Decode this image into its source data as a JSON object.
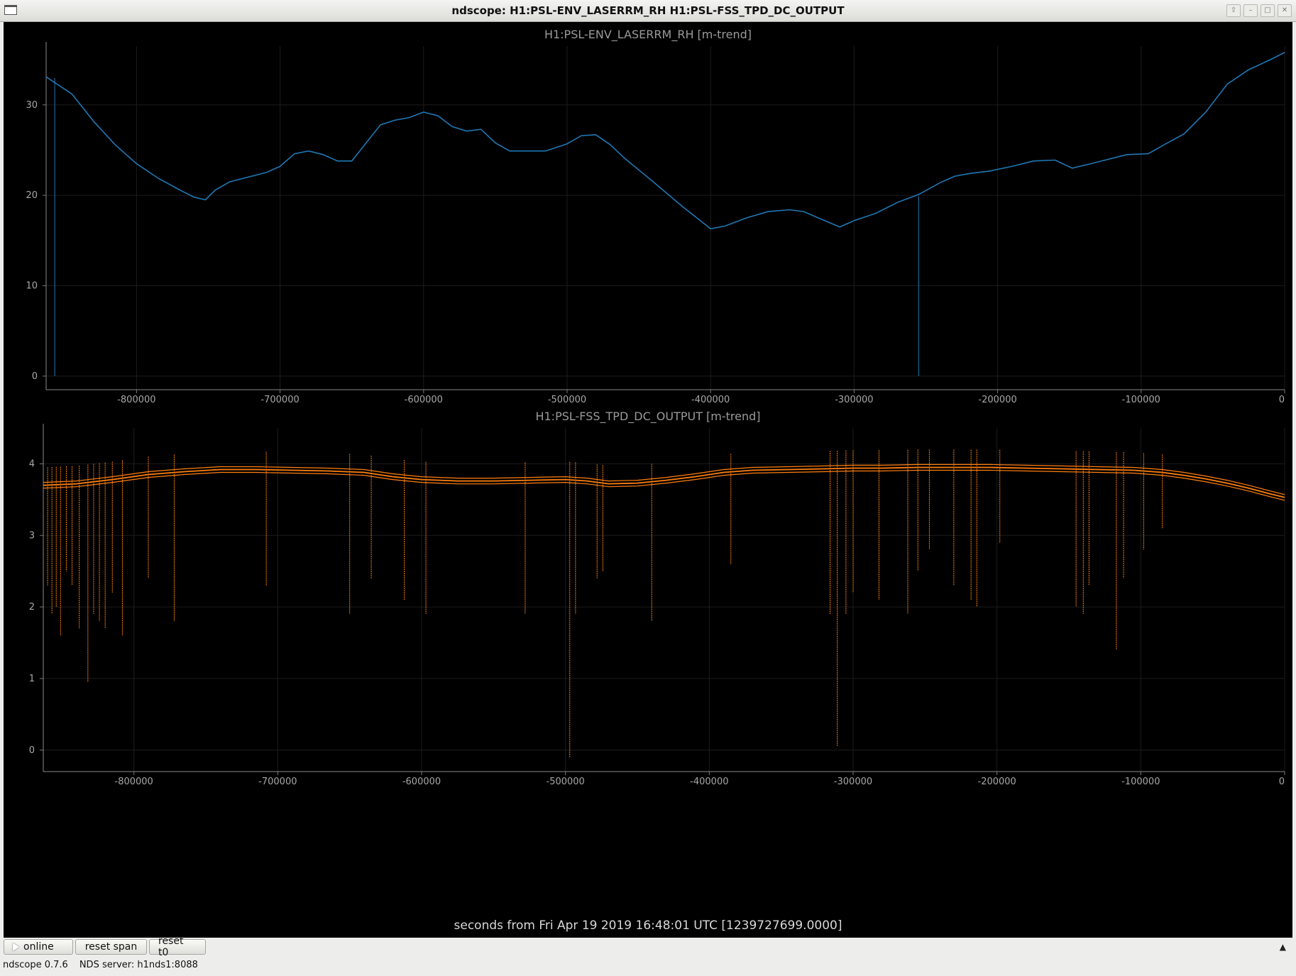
{
  "window": {
    "title": "ndscope: H1:PSL-ENV_LASERRM_RH H1:PSL-FSS_TPD_DC_OUTPUT",
    "buttons": [
      "up-icon",
      "minimize-icon",
      "maximize-icon",
      "close-icon"
    ]
  },
  "plots": [
    {
      "title": "H1:PSL-ENV_LASERRM_RH [m-trend]",
      "color": "#1f77b4",
      "yticks": [
        "0",
        "10",
        "20",
        "30"
      ],
      "xticks": [
        "-800000",
        "-700000",
        "-600000",
        "-500000",
        "-400000",
        "-300000",
        "-200000",
        "-100000",
        "0"
      ]
    },
    {
      "title": "H1:PSL-FSS_TPD_DC_OUTPUT [m-trend]",
      "color": "#ff7f0e",
      "yticks": [
        "0",
        "1",
        "2",
        "3",
        "4"
      ],
      "xticks": [
        "-800000",
        "-700000",
        "-600000",
        "-500000",
        "-400000",
        "-300000",
        "-200000",
        "-100000",
        "0"
      ]
    }
  ],
  "x_axis_label": "seconds from Fri Apr 19 2019 16:48:01 UTC [1239727699.0000]",
  "toolbar": {
    "online_label": "online",
    "reset_span_label": "reset span",
    "reset_t0_label": "reset t0"
  },
  "status": {
    "version": "ndscope 0.7.6",
    "server": "NDS server: h1nds1:8088"
  },
  "chart_data": [
    {
      "type": "line",
      "title": "H1:PSL-ENV_LASERRM_RH [m-trend]",
      "xlim": [
        -863000,
        0
      ],
      "ylim": [
        -1.5,
        36.5
      ],
      "grid": true,
      "series": [
        {
          "color": "#1f77b4",
          "x": [
            -863000,
            -845000,
            -830000,
            -815000,
            -800000,
            -785000,
            -770000,
            -760000,
            -752000,
            -745000,
            -735000,
            -720000,
            -710000,
            -700000,
            -690000,
            -680000,
            -670000,
            -660000,
            -650000,
            -640000,
            -630000,
            -620000,
            -610000,
            -600000,
            -590000,
            -580000,
            -570000,
            -560000,
            -550000,
            -540000,
            -530000,
            -515000,
            -500000,
            -490000,
            -480000,
            -470000,
            -460000,
            -440000,
            -420000,
            -400000,
            -390000,
            -375000,
            -360000,
            -345000,
            -335000,
            -325000,
            -310000,
            -300000,
            -285000,
            -270000,
            -255000,
            -240000,
            -230000,
            -220000,
            -205000,
            -190000,
            -175000,
            -160000,
            -148000,
            -135000,
            -125000,
            -110000,
            -95000,
            -85000,
            -70000,
            -55000,
            -40000,
            -25000,
            -10000,
            0
          ],
          "y": [
            33.1,
            31.2,
            28.2,
            25.6,
            23.5,
            21.9,
            20.6,
            19.8,
            19.5,
            20.6,
            21.5,
            22.1,
            22.5,
            23.2,
            24.6,
            24.9,
            24.5,
            23.8,
            23.8,
            25.8,
            27.8,
            28.3,
            28.6,
            29.2,
            28.8,
            27.6,
            27.1,
            27.3,
            25.8,
            24.9,
            24.9,
            24.9,
            25.7,
            26.6,
            26.7,
            25.6,
            24.1,
            21.5,
            18.8,
            16.3,
            16.6,
            17.5,
            18.2,
            18.4,
            18.2,
            17.5,
            16.5,
            17.2,
            18.0,
            19.2,
            20.1,
            21.4,
            22.1,
            22.4,
            22.7,
            23.2,
            23.8,
            23.9,
            23.0,
            23.5,
            23.9,
            24.5,
            24.6,
            25.5,
            26.8,
            29.2,
            32.3,
            33.9,
            35.0,
            35.8
          ]
        }
      ]
    },
    {
      "type": "line",
      "title": "H1:PSL-FSS_TPD_DC_OUTPUT [m-trend]",
      "xlim": [
        -863000,
        0
      ],
      "ylim": [
        -0.3,
        4.5
      ],
      "grid": true,
      "series": [
        {
          "color": "#ff7f0e",
          "x": [
            -863000,
            -840000,
            -815000,
            -790000,
            -765000,
            -740000,
            -715000,
            -690000,
            -665000,
            -640000,
            -620000,
            -600000,
            -575000,
            -550000,
            -525000,
            -500000,
            -485000,
            -470000,
            -450000,
            -430000,
            -410000,
            -390000,
            -370000,
            -345000,
            -320000,
            -300000,
            -280000,
            -255000,
            -230000,
            -205000,
            -180000,
            -155000,
            -130000,
            -105000,
            -85000,
            -70000,
            -55000,
            -40000,
            -25000,
            -10000,
            0
          ],
          "y": [
            3.7,
            3.72,
            3.78,
            3.85,
            3.89,
            3.92,
            3.92,
            3.91,
            3.9,
            3.88,
            3.82,
            3.78,
            3.76,
            3.76,
            3.77,
            3.78,
            3.76,
            3.72,
            3.73,
            3.77,
            3.82,
            3.88,
            3.91,
            3.92,
            3.93,
            3.94,
            3.94,
            3.95,
            3.95,
            3.95,
            3.94,
            3.93,
            3.92,
            3.91,
            3.88,
            3.84,
            3.79,
            3.73,
            3.66,
            3.58,
            3.53
          ]
        }
      ],
      "dropouts": [
        {
          "x": -860000,
          "y": 2.3
        },
        {
          "x": -857000,
          "y": 1.9
        },
        {
          "x": -854000,
          "y": 2.0
        },
        {
          "x": -851000,
          "y": 1.6
        },
        {
          "x": -847000,
          "y": 2.5
        },
        {
          "x": -843000,
          "y": 2.3
        },
        {
          "x": -838000,
          "y": 1.7
        },
        {
          "x": -832000,
          "y": 0.95
        },
        {
          "x": -828000,
          "y": 1.9
        },
        {
          "x": -824000,
          "y": 1.8
        },
        {
          "x": -820000,
          "y": 1.7
        },
        {
          "x": -815000,
          "y": 2.2
        },
        {
          "x": -808000,
          "y": 1.6
        },
        {
          "x": -790000,
          "y": 2.4
        },
        {
          "x": -772000,
          "y": 1.8
        },
        {
          "x": -708000,
          "y": 2.3
        },
        {
          "x": -650000,
          "y": 1.9
        },
        {
          "x": -635000,
          "y": 2.4
        },
        {
          "x": -612000,
          "y": 2.1
        },
        {
          "x": -597000,
          "y": 1.9
        },
        {
          "x": -528000,
          "y": 1.9
        },
        {
          "x": -497000,
          "y": -0.1
        },
        {
          "x": -493000,
          "y": 1.9
        },
        {
          "x": -478000,
          "y": 2.4
        },
        {
          "x": -474000,
          "y": 2.5
        },
        {
          "x": -440000,
          "y": 1.8
        },
        {
          "x": -385000,
          "y": 2.6
        },
        {
          "x": -316000,
          "y": 1.9
        },
        {
          "x": -311000,
          "y": 0.05
        },
        {
          "x": -305000,
          "y": 1.9
        },
        {
          "x": -300000,
          "y": 2.2
        },
        {
          "x": -282000,
          "y": 2.1
        },
        {
          "x": -262000,
          "y": 1.9
        },
        {
          "x": -255000,
          "y": 2.5
        },
        {
          "x": -247000,
          "y": 2.8
        },
        {
          "x": -230000,
          "y": 2.3
        },
        {
          "x": -218000,
          "y": 2.1
        },
        {
          "x": -214000,
          "y": 2.0
        },
        {
          "x": -198000,
          "y": 2.9
        },
        {
          "x": -145000,
          "y": 2.0
        },
        {
          "x": -140000,
          "y": 1.9
        },
        {
          "x": -136000,
          "y": 2.3
        },
        {
          "x": -117000,
          "y": 1.4
        },
        {
          "x": -112000,
          "y": 2.4
        },
        {
          "x": -98000,
          "y": 2.8
        },
        {
          "x": -85000,
          "y": 3.1
        }
      ]
    }
  ]
}
